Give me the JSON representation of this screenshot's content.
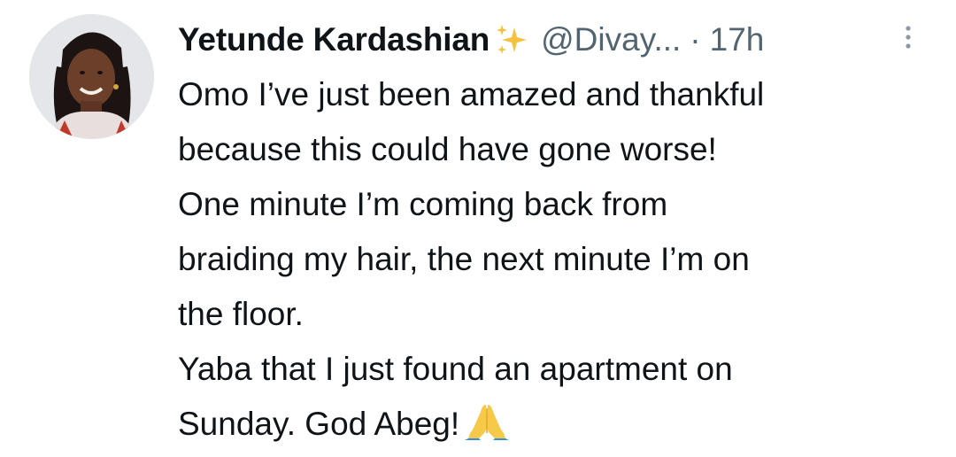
{
  "tweet": {
    "display_name": "Yetunde Kardashian",
    "handle": "@Divay...",
    "separator": "·",
    "time": "17h",
    "lines": [
      "Omo I’ve just been amazed and thankful",
      "because this could have gone worse!",
      "One minute I’m coming back from",
      "braiding my hair, the next minute I’m on",
      "the floor.",
      "Yaba that I just found an apartment on",
      "Sunday. God Abeg!"
    ],
    "name_emoji": "sparkles-icon",
    "end_emoji": "folded-hands-icon"
  },
  "colors": {
    "text": "#0f1419",
    "secondary": "#536471",
    "sparkle": "#f4c23c"
  }
}
